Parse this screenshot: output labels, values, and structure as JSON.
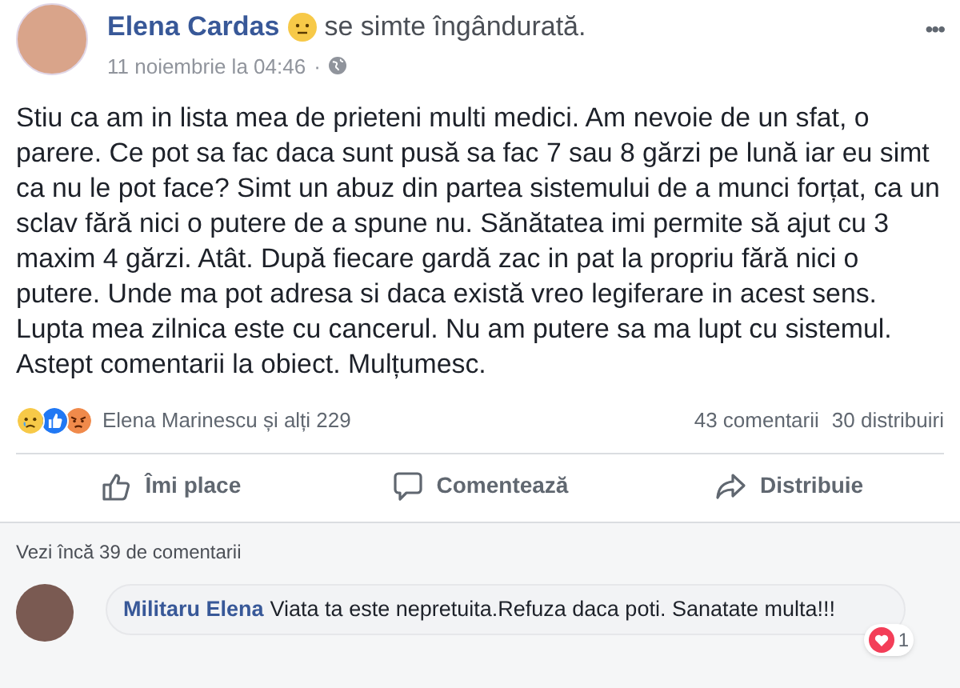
{
  "author": {
    "name": "Elena Cardas",
    "feeling": "se simte îngândurată.",
    "timestamp": "11 noiembrie la 04:46",
    "separator": "·"
  },
  "menu": "•••",
  "body": "Stiu ca am in lista mea de prieteni multi medici. Am nevoie de un sfat, o parere. Ce pot sa fac daca sunt pusă sa fac 7 sau 8 gărzi pe lună iar eu simt ca nu le pot face? Simt un abuz din partea sistemului de a munci forțat, ca un sclav fără nici o putere de a spune nu. Sănătatea imi permite să ajut cu 3 maxim 4 gărzi. Atât. După fiecare gardă zac in pat la propriu fără nici o putere. Unde ma pot adresa si daca există vreo legiferare in acest sens. Lupta mea zilnica este cu cancerul. Nu am putere sa ma lupt cu sistemul. Astept comentarii la obiect. Mulțumesc.",
  "reactions": [
    {
      "kind": "sad"
    },
    {
      "kind": "like"
    },
    {
      "kind": "angry"
    }
  ],
  "reactions_label": "Elena Marinescu și alți 229",
  "comments_count": "43 comentarii",
  "shares_count": "30 distribuiri",
  "actions": [
    {
      "kind": "like",
      "label": "Îmi place"
    },
    {
      "kind": "comment",
      "label": "Comentează"
    },
    {
      "kind": "share",
      "label": "Distribuie"
    }
  ],
  "more_comments": "Vezi încă 39 de comentarii",
  "comment": {
    "author": "Militaru Elena",
    "text": "Viata ta este nepretuita.Refuza daca poti. Sanatate multa!!!",
    "reaction_count": "1"
  }
}
